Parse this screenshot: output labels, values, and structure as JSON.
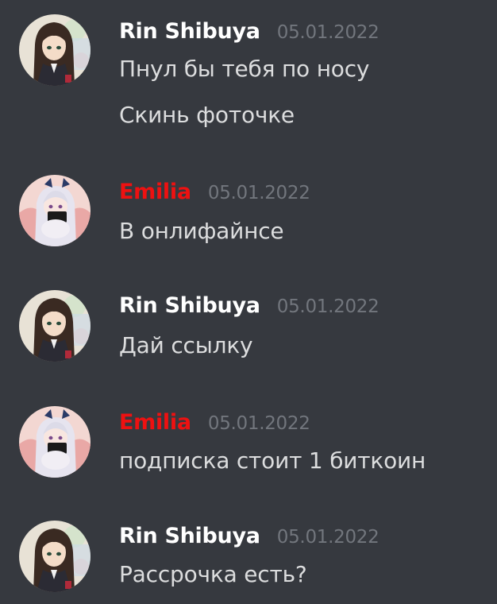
{
  "colors": {
    "background": "#36393f",
    "rin_name": "#ffffff",
    "emilia_name": "#ee1111",
    "timestamp": "#72767d",
    "message_text": "#dcddde"
  },
  "messages": [
    {
      "author": "Rin Shibuya",
      "author_color": "#ffffff",
      "avatar_icon": "rin-shibuya-avatar",
      "timestamp": "05.01.2022",
      "lines": [
        "Пнул бы тебя по носу",
        "Скинь фоточке"
      ]
    },
    {
      "author": "Emilia",
      "author_color": "#ee1111",
      "avatar_icon": "emilia-avatar",
      "timestamp": "05.01.2022",
      "lines": [
        "В онлифайнсе"
      ]
    },
    {
      "author": "Rin Shibuya",
      "author_color": "#ffffff",
      "avatar_icon": "rin-shibuya-avatar",
      "timestamp": "05.01.2022",
      "lines": [
        "Дай ссылку"
      ]
    },
    {
      "author": "Emilia",
      "author_color": "#ee1111",
      "avatar_icon": "emilia-avatar",
      "timestamp": "05.01.2022",
      "lines": [
        "подписка стоит 1 биткоин"
      ]
    },
    {
      "author": "Rin Shibuya",
      "author_color": "#ffffff",
      "avatar_icon": "rin-shibuya-avatar",
      "timestamp": "05.01.2022",
      "lines": [
        "Рассрочка есть?"
      ]
    }
  ]
}
